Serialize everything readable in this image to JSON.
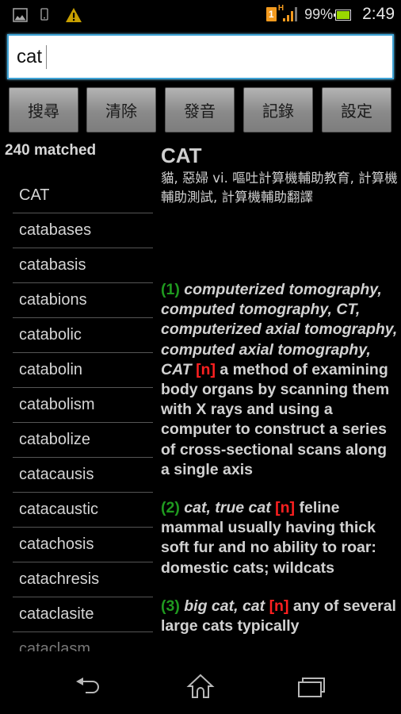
{
  "status_bar": {
    "left_icons": [
      "gallery-icon",
      "phone-device-icon",
      "warning-icon"
    ],
    "sim_label": "1",
    "network_type": "H",
    "battery_percent": "99%",
    "time": "2:49",
    "colors": {
      "warning": "#c8a000",
      "signal": "#f39a1e",
      "battery": "#9ad800"
    }
  },
  "search": {
    "value": "cat",
    "placeholder": ""
  },
  "toolbar": {
    "buttons": [
      {
        "label": "搜尋"
      },
      {
        "label": "清除"
      },
      {
        "label": "發音"
      },
      {
        "label": "記錄"
      },
      {
        "label": "設定"
      }
    ]
  },
  "results": {
    "matched_label": "240 matched",
    "items": [
      "CAT",
      "catabases",
      "catabasis",
      "catabions",
      "catabolic",
      "catabolin",
      "catabolism",
      "catabolize",
      "catacausis",
      "catacaustic",
      "catachosis",
      "catachresis",
      "cataclasite",
      "cataclasm"
    ]
  },
  "entry": {
    "headword": "CAT",
    "chinese": "貓, 惡婦 vi. 嘔吐計算機輔助教育, 計算機輔助測試, 計算機輔助翻譯",
    "senses": [
      {
        "num": "(1)",
        "synonyms": "computerized tomography, computed tomography, CT, computerized axial tomography, computed axial tomography, CAT",
        "pos": "[n]",
        "definition": "a method of examining body organs by scanning them with X rays and using a computer to construct a series of cross-sectional scans along a single axis"
      },
      {
        "num": "(2)",
        "synonyms": "cat, true cat",
        "pos": "[n]",
        "definition": "feline mammal usually having thick soft fur and no ability to roar: domestic cats; wildcats"
      },
      {
        "num": "(3)",
        "synonyms": "big cat, cat",
        "pos": "[n]",
        "definition": "any of several large cats typically"
      }
    ]
  },
  "nav_bar": {
    "buttons": [
      "back-icon",
      "home-icon",
      "recent-apps-icon"
    ]
  }
}
